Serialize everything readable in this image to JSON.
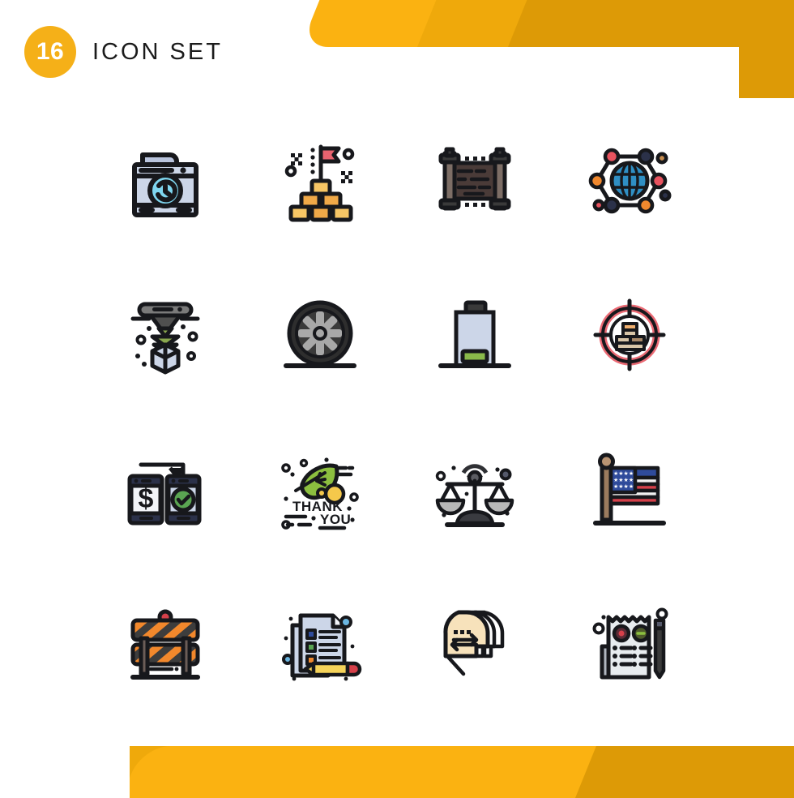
{
  "header": {
    "count": "16",
    "title": "Icon Set"
  },
  "theme": {
    "brand_yellow": "#f5b018",
    "ribbon_light": "#fbb211",
    "ribbon_mid": "#efa90b",
    "ribbon_dark": "#dd9a06",
    "background": "#ffffff",
    "stroke": "#17181c",
    "paper_blue": "#ccd6e8",
    "cyan": "#7fd6ef",
    "gold": "#f7c665",
    "gold_deep": "#f0a948",
    "red": "#e8636f",
    "orange": "#f0882e",
    "green": "#7cb342",
    "navy": "#2b3149",
    "grey": "#a8a8a8",
    "wood": "#4a3b38",
    "skin": "#f7e2bb"
  },
  "grid": {
    "columns": 4,
    "rows": 4,
    "icons": [
      {
        "id": "washing-machine-icon",
        "label": "Washing Machine"
      },
      {
        "id": "gold-bars-flag-icon",
        "label": "Gold Bars Goal"
      },
      {
        "id": "wooden-fence-icon",
        "label": "Wooden Fence"
      },
      {
        "id": "global-network-icon",
        "label": "Global Network"
      },
      {
        "id": "3d-printer-icon",
        "label": "3D Printer"
      },
      {
        "id": "wheel-icon",
        "label": "Wheel"
      },
      {
        "id": "low-battery-icon",
        "label": "Low Battery"
      },
      {
        "id": "target-stack-icon",
        "label": "Target Stack"
      },
      {
        "id": "mobile-payment-icon",
        "label": "Mobile Payment"
      },
      {
        "id": "thank-you-leaf-icon",
        "label": "Thank You Leaf"
      },
      {
        "id": "justice-scales-icon",
        "label": "Justice Scales"
      },
      {
        "id": "usa-flag-icon",
        "label": "USA Flag"
      },
      {
        "id": "road-barrier-icon",
        "label": "Road Barrier"
      },
      {
        "id": "checklist-pencil-icon",
        "label": "Checklist Pencil"
      },
      {
        "id": "heads-exchange-icon",
        "label": "Heads Exchange"
      },
      {
        "id": "survey-pen-icon",
        "label": "Survey Pen"
      }
    ]
  },
  "icon_text": {
    "thank_you_line1": "THANK",
    "thank_you_line2": "YOU",
    "dollar_symbol": "$"
  }
}
